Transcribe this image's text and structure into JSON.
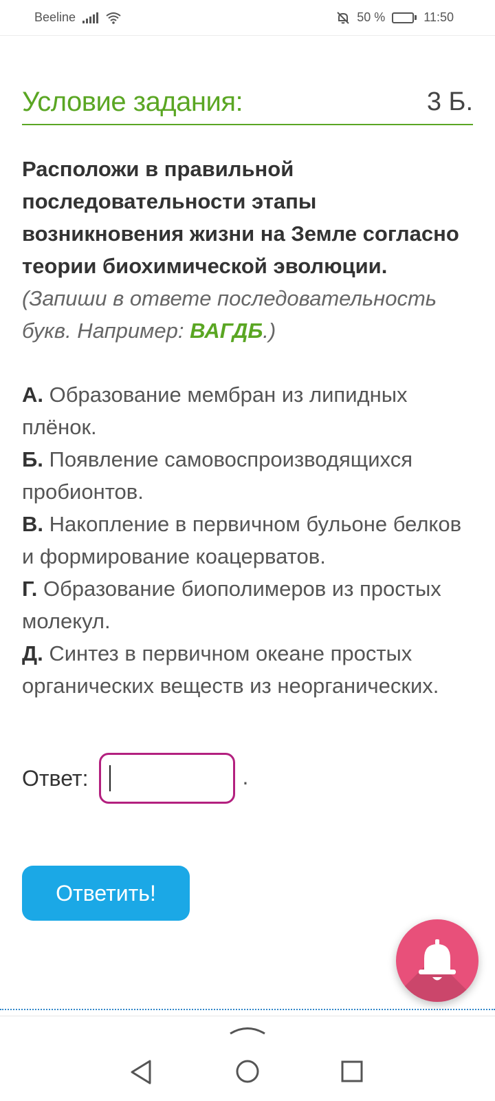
{
  "status_bar": {
    "carrier": "Beeline",
    "battery_percent": "50 %",
    "battery_level": 0.5,
    "time": "11:50",
    "icons": [
      "signal-icon",
      "wifi-icon",
      "bell-off-icon",
      "battery-icon"
    ]
  },
  "task": {
    "header_title": "Условие задания:",
    "points": "3 Б.",
    "question_bold": "Расположи в правильной последовательности этапы возникновения жизни на Земле согласно теории биохимической эволюции.",
    "hint_prefix": "(Запиши в ответе последовательность букв. Например:",
    "hint_example": "ВАГДБ",
    "hint_suffix": ".)",
    "options": [
      {
        "letter": "А.",
        "text": "Образование мембран из липидных плёнок."
      },
      {
        "letter": "Б.",
        "text": "Появление самовоспроизводящихся пробионтов."
      },
      {
        "letter": "В.",
        "text": "Накопление в первичном бульоне белков и формирование коацерватов."
      },
      {
        "letter": "Г.",
        "text": "Образование биополимеров из простых молекул."
      },
      {
        "letter": "Д.",
        "text": "Синтез в первичном океане простых органических веществ из неорганических."
      }
    ]
  },
  "answer": {
    "label": "Ответ:",
    "value": "",
    "trailing": "."
  },
  "submit_button": {
    "label": "Ответить!"
  },
  "colors": {
    "accent_green": "#5aa623",
    "button_blue": "#1ba8e6",
    "input_border": "#b3207f",
    "fab_pink": "#e8507a"
  },
  "fab": {
    "icon": "bell-icon"
  },
  "nav_bar": {
    "icons": [
      "chevron-up-icon",
      "back-icon",
      "home-icon",
      "recent-apps-icon"
    ]
  }
}
